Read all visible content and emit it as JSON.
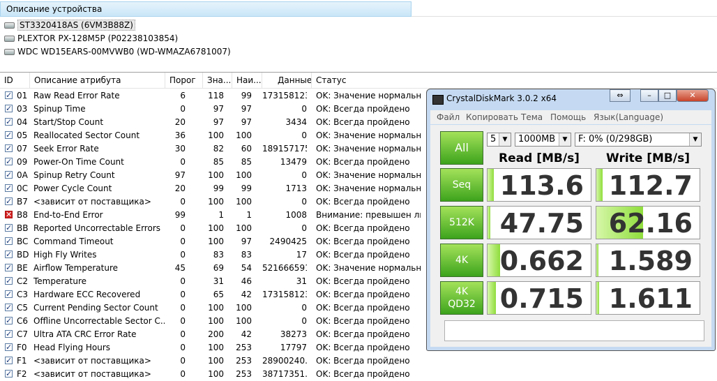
{
  "description": {
    "header": "Описание устройства",
    "devices": [
      "ST3320418AS (6VM3B88Z)",
      "PLEXTOR PX-128M5P (P02238103854)",
      "WDC WD15EARS-00MVWB0 (WD-WMAZA6781007)"
    ]
  },
  "attributes": {
    "columns": [
      "ID",
      "Описание атрибута",
      "Порог",
      "Зна...",
      "Наи...",
      "Данные",
      "Статус"
    ],
    "rows": [
      {
        "id": "01",
        "name": "Raw Read Error Rate",
        "thr": "6",
        "val": "118",
        "worst": "99",
        "data": "173158123",
        "status": "OK: Значение нормальное",
        "state": "ok"
      },
      {
        "id": "03",
        "name": "Spinup Time",
        "thr": "0",
        "val": "97",
        "worst": "97",
        "data": "0",
        "status": "OK: Всегда пройдено",
        "state": "ok"
      },
      {
        "id": "04",
        "name": "Start/Stop Count",
        "thr": "20",
        "val": "97",
        "worst": "97",
        "data": "3434",
        "status": "OK: Всегда пройдено",
        "state": "ok"
      },
      {
        "id": "05",
        "name": "Reallocated Sector Count",
        "thr": "36",
        "val": "100",
        "worst": "100",
        "data": "0",
        "status": "OK: Значение нормальное",
        "state": "ok"
      },
      {
        "id": "07",
        "name": "Seek Error Rate",
        "thr": "30",
        "val": "82",
        "worst": "60",
        "data": "189157175",
        "status": "OK: Значение нормальное",
        "state": "ok"
      },
      {
        "id": "09",
        "name": "Power-On Time Count",
        "thr": "0",
        "val": "85",
        "worst": "85",
        "data": "13479",
        "status": "OK: Всегда пройдено",
        "state": "ok"
      },
      {
        "id": "0A",
        "name": "Spinup Retry Count",
        "thr": "97",
        "val": "100",
        "worst": "100",
        "data": "0",
        "status": "OK: Значение нормальное",
        "state": "ok"
      },
      {
        "id": "0C",
        "name": "Power Cycle Count",
        "thr": "20",
        "val": "99",
        "worst": "99",
        "data": "1713",
        "status": "OK: Значение нормальное",
        "state": "ok"
      },
      {
        "id": "B7",
        "name": "<зависит от поставщика>",
        "thr": "0",
        "val": "100",
        "worst": "100",
        "data": "0",
        "status": "OK: Всегда пройдено",
        "state": "ok"
      },
      {
        "id": "B8",
        "name": "End-to-End Error",
        "thr": "99",
        "val": "1",
        "worst": "1",
        "data": "1008",
        "status": "Внимание: превышен ли...",
        "state": "error"
      },
      {
        "id": "BB",
        "name": "Reported Uncorrectable Errors",
        "thr": "0",
        "val": "100",
        "worst": "100",
        "data": "0",
        "status": "OK: Всегда пройдено",
        "state": "ok"
      },
      {
        "id": "BC",
        "name": "Command Timeout",
        "thr": "0",
        "val": "100",
        "worst": "97",
        "data": "2490425",
        "status": "OK: Всегда пройдено",
        "state": "ok"
      },
      {
        "id": "BD",
        "name": "High Fly Writes",
        "thr": "0",
        "val": "83",
        "worst": "83",
        "data": "17",
        "status": "OK: Всегда пройдено",
        "state": "ok"
      },
      {
        "id": "BE",
        "name": "Airflow Temperature",
        "thr": "45",
        "val": "69",
        "worst": "54",
        "data": "521666591",
        "status": "OK: Значение нормальное",
        "state": "ok"
      },
      {
        "id": "C2",
        "name": "Temperature",
        "thr": "0",
        "val": "31",
        "worst": "46",
        "data": "31",
        "status": "OK: Всегда пройдено",
        "state": "ok"
      },
      {
        "id": "C3",
        "name": "Hardware ECC Recovered",
        "thr": "0",
        "val": "65",
        "worst": "42",
        "data": "173158123",
        "status": "OK: Всегда пройдено",
        "state": "ok"
      },
      {
        "id": "C5",
        "name": "Current Pending Sector Count",
        "thr": "0",
        "val": "100",
        "worst": "100",
        "data": "0",
        "status": "OK: Всегда пройдено",
        "state": "ok"
      },
      {
        "id": "C6",
        "name": "Offline Uncorrectable Sector C...",
        "thr": "0",
        "val": "100",
        "worst": "100",
        "data": "0",
        "status": "OK: Всегда пройдено",
        "state": "ok"
      },
      {
        "id": "C7",
        "name": "Ultra ATA CRC Error Rate",
        "thr": "0",
        "val": "200",
        "worst": "42",
        "data": "38273",
        "status": "OK: Всегда пройдено",
        "state": "ok"
      },
      {
        "id": "F0",
        "name": "Head Flying Hours",
        "thr": "0",
        "val": "100",
        "worst": "253",
        "data": "17797",
        "status": "OK: Всегда пройдено",
        "state": "ok"
      },
      {
        "id": "F1",
        "name": "<зависит от поставщика>",
        "thr": "0",
        "val": "100",
        "worst": "253",
        "data": "28900240...",
        "status": "OK: Всегда пройдено",
        "state": "ok"
      },
      {
        "id": "F2",
        "name": "<зависит от поставщика>",
        "thr": "0",
        "val": "100",
        "worst": "253",
        "data": "38717351...",
        "status": "OK: Всегда пройдено",
        "state": "ok"
      }
    ]
  },
  "cdm": {
    "title": "CrystalDiskMark 3.0.2 x64",
    "window_buttons": {
      "move": "⇔",
      "minimize": "–",
      "maximize": "□",
      "close": "✕"
    },
    "menu": [
      "Файл",
      "Копировать",
      "Тема",
      "Помощь",
      "Язык(Language)"
    ],
    "all_label": "All",
    "count_value": "5",
    "size_value": "1000MB",
    "drive_value": "F: 0% (0/298GB)",
    "read_header": "Read [MB/s]",
    "write_header": "Write [MB/s]",
    "tests": [
      {
        "label": "Seq",
        "read": "113.6",
        "write": "112.7",
        "read_fill": 0.06,
        "write_fill": 0.06
      },
      {
        "label": "512K",
        "read": "47.75",
        "write": "62.16",
        "read_fill": 0.03,
        "write_fill": 0.45
      },
      {
        "label": "4K",
        "read": "0.662",
        "write": "1.589",
        "read_fill": 0.12,
        "write_fill": 0.02
      },
      {
        "label": "4K\nQD32",
        "read": "0.715",
        "write": "1.611",
        "read_fill": 0.08,
        "write_fill": 0.03
      }
    ],
    "comment": "",
    "bar_color": "#8fdd3c",
    "button_color": "#3da31c"
  }
}
